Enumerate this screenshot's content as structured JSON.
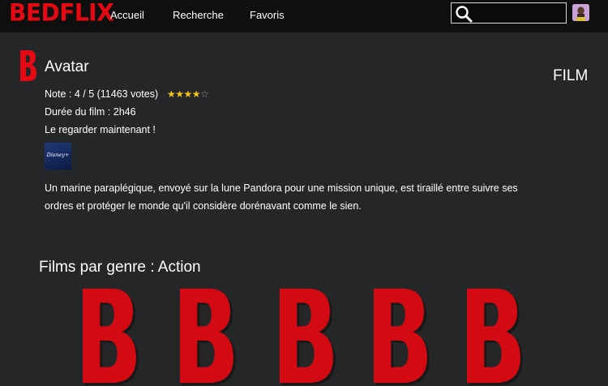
{
  "app": {
    "brand": "BEDFLIX"
  },
  "nav": {
    "home": "Accueil",
    "search": "Recherche",
    "favorites": "Favoris"
  },
  "search": {
    "value": "",
    "placeholder": ""
  },
  "film": {
    "title": "Avatar",
    "type_label": "FILM",
    "rating_line": "Note : 4 / 5 (11463 votes)",
    "rating_value": 4,
    "rating_max": 5,
    "duration_line": "Durée du film : 2h46",
    "watch_now": "Le regarder maintenant !",
    "provider_text": "Disney+",
    "synopsis": "Un marine paraplégique, envoyé sur la lune Pandora pour une mission unique, est tiraillé entre suivre ses ordres et protéger le monde qu'il considère dorénavant comme le sien."
  },
  "genre_section": {
    "title": "Films par genre : Action",
    "posters": [
      {
        "icon": "bedflix-b-logo"
      },
      {
        "icon": "bedflix-b-logo"
      },
      {
        "icon": "bedflix-b-logo"
      },
      {
        "icon": "bedflix-b-logo"
      },
      {
        "icon": "bedflix-b-logo"
      }
    ]
  },
  "colors": {
    "brand_red": "#e50914",
    "background": "#252627",
    "topbar": "#0f0f0f",
    "star": "#f5c518"
  }
}
